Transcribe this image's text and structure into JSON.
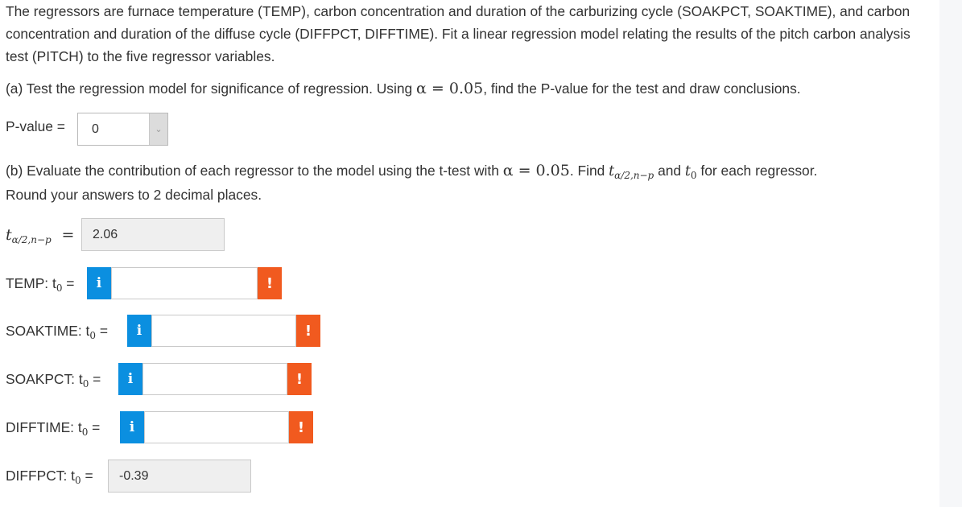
{
  "intro": "The regressors are furnace temperature (TEMP), carbon concentration and duration of the carburizing cycle (SOAKPCT, SOAKTIME), and carbon concentration and duration of the diffuse cycle (DIFFPCT, DIFFTIME). Fit a linear regression model relating the results of the pitch carbon analysis test (PITCH) to the five regressor variables.",
  "part_a": {
    "text_before": "(a) Test the regression model for significance of regression. Using ",
    "alpha_expr": "α = 0.05",
    "text_after": ", find the P-value for the test and draw conclusions.",
    "pvalue_label": "P-value =",
    "pvalue_value": "0"
  },
  "part_b": {
    "text_before": "(b) Evaluate the contribution of each regressor to the model using the t-test with ",
    "alpha_expr": "α = 0.05",
    "text_mid": ". Find ",
    "t_crit_main": "t",
    "t_crit_sub": "α/2,n−p",
    "text_and": " and ",
    "t0_main": "t",
    "t0_sub": "0",
    "text_after": " for each regressor.",
    "round_note": "Round your answers to 2 decimal places."
  },
  "t_critical": {
    "label_main": "t",
    "label_sub": "α/2,n−p",
    "equals": "=",
    "value": "2.06"
  },
  "rows": {
    "temp": {
      "label": "TEMP: t",
      "sub": "0",
      "eq": " ="
    },
    "soaktime": {
      "label": "SOAKTIME: t",
      "sub": "0",
      "eq": " ="
    },
    "soakpct": {
      "label": "SOAKPCT: t",
      "sub": "0",
      "eq": " ="
    },
    "difftime": {
      "label": "DIFFTIME: t",
      "sub": "0",
      "eq": " ="
    },
    "diffpct": {
      "label": "DIFFPCT: t",
      "sub": "0",
      "eq": " =",
      "value": "-0.39"
    }
  },
  "icons": {
    "info": "i",
    "warning": "!"
  },
  "colors": {
    "info_blue": "#0b8fe0",
    "warning_orange": "#f15a1f",
    "readonly_gray": "#efefef"
  }
}
